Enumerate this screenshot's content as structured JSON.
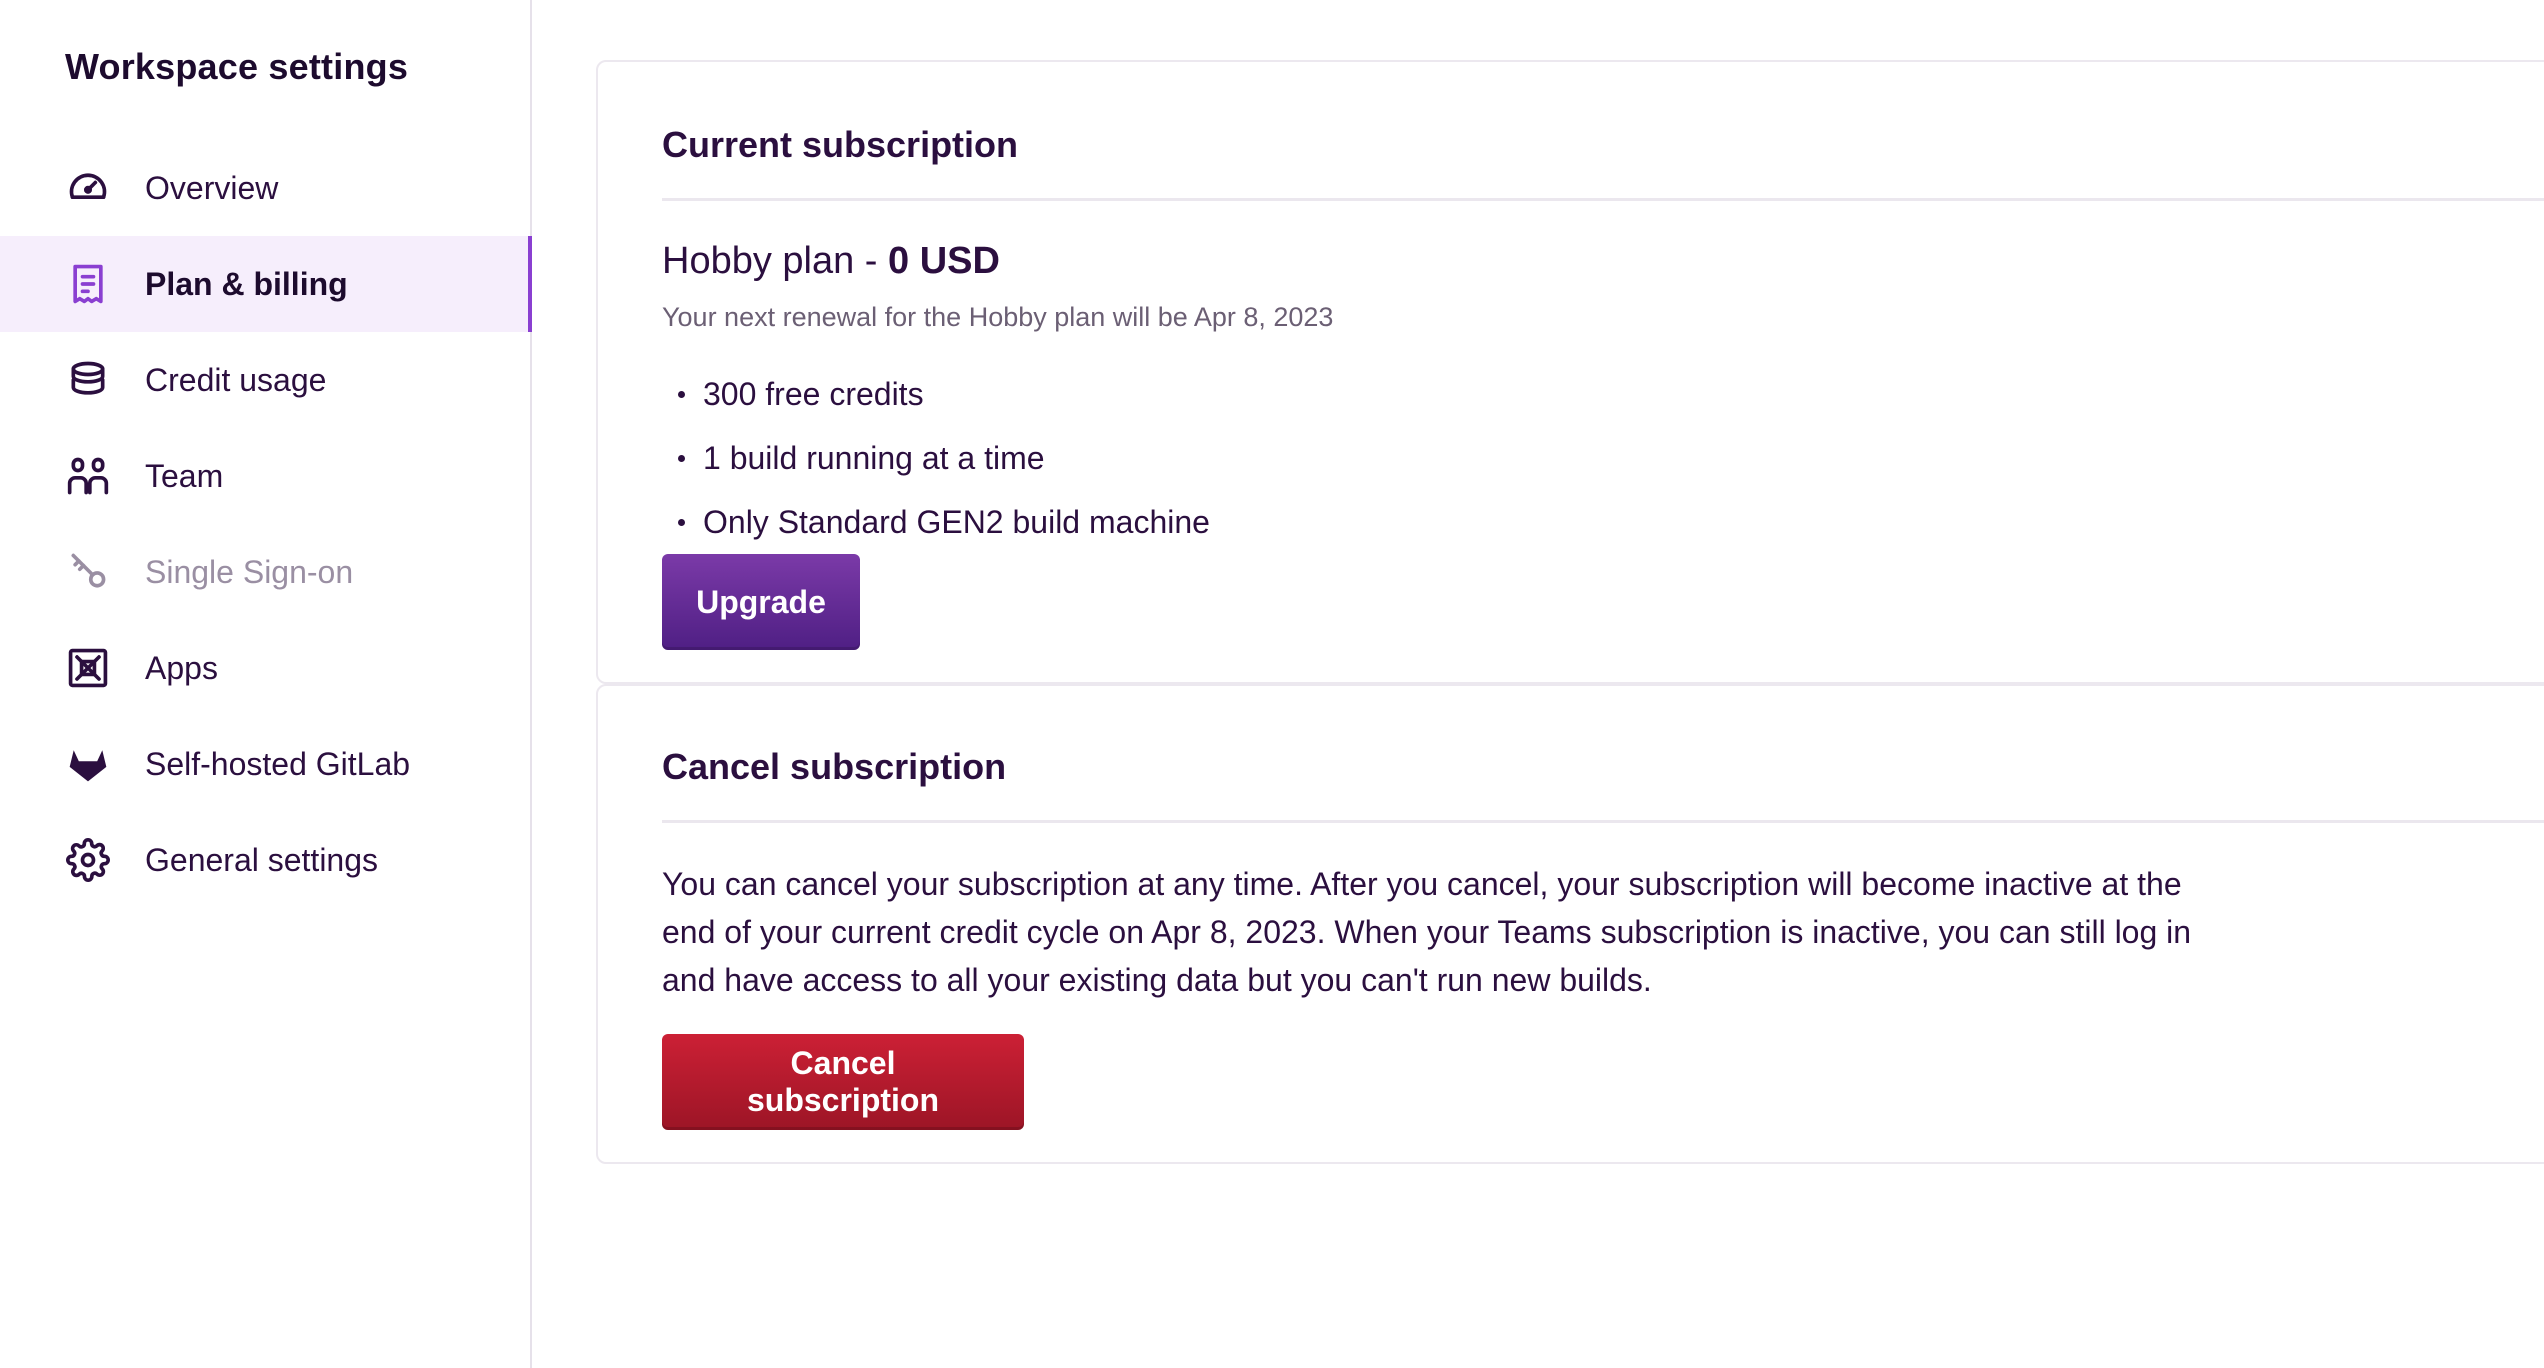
{
  "sidebar": {
    "title": "Workspace settings",
    "items": [
      {
        "label": "Overview",
        "icon": "gauge-icon"
      },
      {
        "label": "Plan & billing",
        "icon": "receipt-icon",
        "active": true
      },
      {
        "label": "Credit usage",
        "icon": "coins-stack-icon"
      },
      {
        "label": "Team",
        "icon": "team-icon"
      },
      {
        "label": "Single Sign-on",
        "icon": "key-icon",
        "disabled": true
      },
      {
        "label": "Apps",
        "icon": "apps-box-icon"
      },
      {
        "label": "Self-hosted GitLab",
        "icon": "gitlab-icon"
      },
      {
        "label": "General settings",
        "icon": "gear-icon"
      }
    ]
  },
  "current_subscription": {
    "title": "Current subscription",
    "plan_name": "Hobby plan - ",
    "plan_price": "0 USD",
    "renewal": "Your next renewal for the Hobby plan will be Apr 8, 2023",
    "features": [
      "300 free credits",
      "1 build running at a time",
      "Only Standard GEN2 build machine"
    ],
    "upgrade_label": "Upgrade"
  },
  "cancel_subscription": {
    "title": "Cancel subscription",
    "description": "You can cancel your subscription at any time. After you cancel, your subscription will become inactive at the end of your current credit cycle on Apr 8, 2023. When your Teams subscription is inactive, you can still log in and have access to all your existing data but you can't run new builds.",
    "button_label": "Cancel subscription"
  },
  "colors": {
    "accent": "#8a3fd1",
    "active_bg": "#f6eefc",
    "text": "#2b0f3f",
    "upgrade_button": "#5b2490",
    "danger_button": "#b81a2e"
  }
}
